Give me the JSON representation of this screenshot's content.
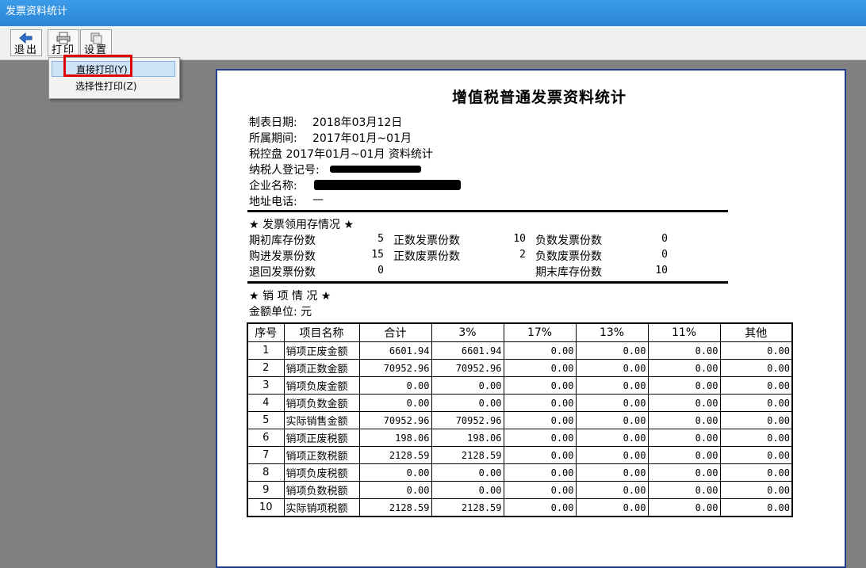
{
  "window": {
    "title": "发票资料统计"
  },
  "toolbar": {
    "exit_label": "退出",
    "print_label": "打印",
    "settings_label": "设置"
  },
  "print_menu": {
    "items": [
      "直接打印(Y)",
      "选择性打印(Z)"
    ],
    "selected": "直接打印(Y)"
  },
  "report": {
    "title": "增值税普通发票资料统计",
    "date_label": "制表日期:",
    "date_value": "2018年03月12日",
    "period_label": "所属期间:",
    "period_value": "2017年01月~01月",
    "disk_line": "税控盘 2017年01月~01月 资料统计",
    "taxpayer_label": "纳税人登记号:",
    "company_label": "企业名称:",
    "address_label": "地址电话:",
    "address_value": "—",
    "inventory": {
      "header": "★ 发票领用存情况 ★",
      "items": [
        {
          "label": "期初库存份数",
          "value": "5"
        },
        {
          "label": "正数发票份数",
          "value": "10"
        },
        {
          "label": "负数发票份数",
          "value": "0"
        },
        {
          "label": "购进发票份数",
          "value": "15"
        },
        {
          "label": "正数废票份数",
          "value": "2"
        },
        {
          "label": "负数废票份数",
          "value": "0"
        },
        {
          "label": "退回发票份数",
          "value": "0"
        },
        {
          "label": "期末库存份数",
          "value": "10"
        }
      ]
    },
    "sales": {
      "header": "★ 销 项 情 况 ★",
      "unit": "金额单位: 元",
      "columns": [
        "序号",
        "项目名称",
        "合计",
        "3%",
        "17%",
        "13%",
        "11%",
        "其他"
      ],
      "rows": [
        [
          "1",
          "销项正废金额",
          "6601.94",
          "6601.94",
          "0.00",
          "0.00",
          "0.00",
          "0.00"
        ],
        [
          "2",
          "销项正数金额",
          "70952.96",
          "70952.96",
          "0.00",
          "0.00",
          "0.00",
          "0.00"
        ],
        [
          "3",
          "销项负废金额",
          "0.00",
          "0.00",
          "0.00",
          "0.00",
          "0.00",
          "0.00"
        ],
        [
          "4",
          "销项负数金额",
          "0.00",
          "0.00",
          "0.00",
          "0.00",
          "0.00",
          "0.00"
        ],
        [
          "5",
          "实际销售金额",
          "70952.96",
          "70952.96",
          "0.00",
          "0.00",
          "0.00",
          "0.00"
        ],
        [
          "6",
          "销项正废税额",
          "198.06",
          "198.06",
          "0.00",
          "0.00",
          "0.00",
          "0.00"
        ],
        [
          "7",
          "销项正数税额",
          "2128.59",
          "2128.59",
          "0.00",
          "0.00",
          "0.00",
          "0.00"
        ],
        [
          "8",
          "销项负废税额",
          "0.00",
          "0.00",
          "0.00",
          "0.00",
          "0.00",
          "0.00"
        ],
        [
          "9",
          "销项负数税额",
          "0.00",
          "0.00",
          "0.00",
          "0.00",
          "0.00",
          "0.00"
        ],
        [
          "10",
          "实际销项税额",
          "2128.59",
          "2128.59",
          "0.00",
          "0.00",
          "0.00",
          "0.00"
        ]
      ]
    }
  },
  "colors": {
    "titlebar": "#2a86d6",
    "highlight_box": "#e00000",
    "paper_border": "#1e3f90"
  }
}
